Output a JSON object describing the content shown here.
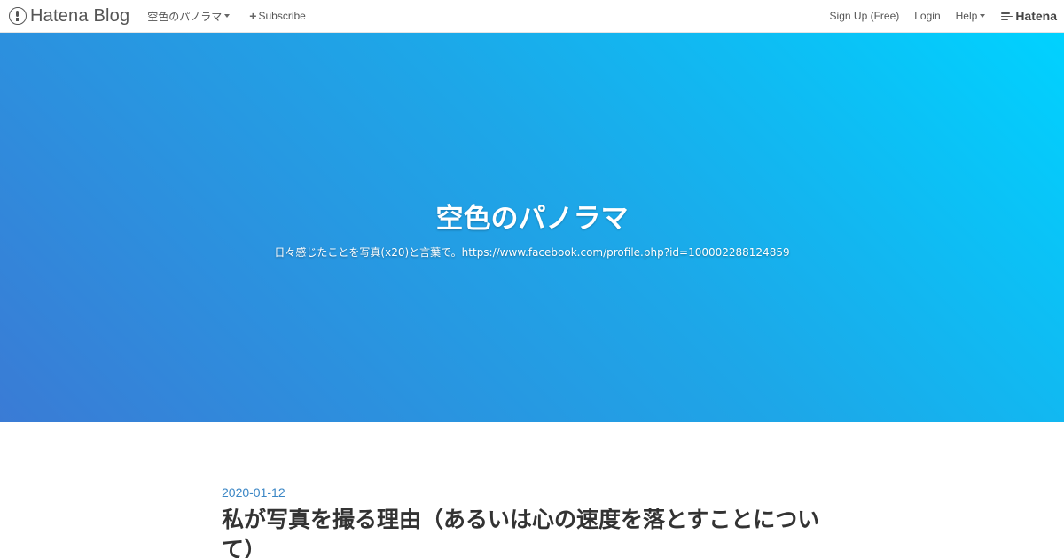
{
  "topbar": {
    "brand": "Hatena Blog",
    "blog_menu": "空色のパノラマ",
    "subscribe": "Subscribe",
    "signup": "Sign Up (Free)",
    "login": "Login",
    "help": "Help",
    "hatena": "Hatena"
  },
  "hero": {
    "title": "空色のパノラマ",
    "description": "日々感じたことを写真(x20)と言葉で。",
    "description_link": "https://www.facebook.com/profile.php?id=100002288124859"
  },
  "article": {
    "date": "2020-01-12",
    "title": "私が写真を撮る理由（あるいは心の速度を落とすことについて）"
  },
  "icons": {
    "brand": "hatena-blog-logo-icon",
    "subscribe": "plus-icon",
    "dropdown": "caret-down-icon",
    "hatena": "hatena-lines-icon"
  },
  "colors": {
    "gradient_start": "#00d2ff",
    "gradient_end": "#3a7bd5",
    "date_link": "#3a86c5"
  }
}
